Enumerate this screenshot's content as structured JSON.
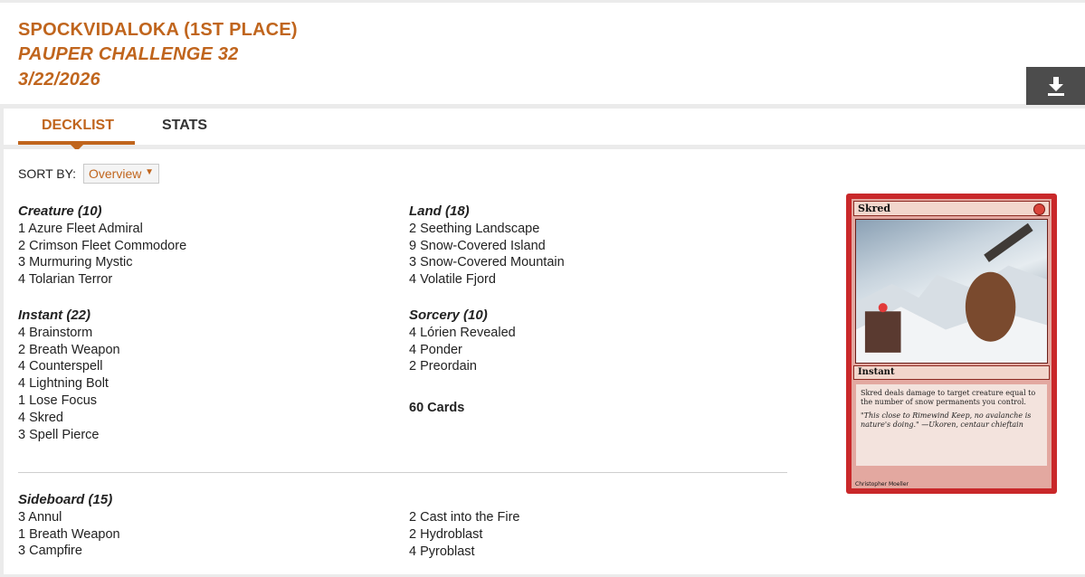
{
  "header": {
    "player": "SPOCKVIDALOKA (1ST PLACE)",
    "event": "PAUPER CHALLENGE 32",
    "date": "3/22/2026",
    "download_icon": "download-icon"
  },
  "tabs": [
    {
      "label": "DECKLIST",
      "active": true
    },
    {
      "label": "STATS",
      "active": false
    }
  ],
  "sort": {
    "label": "SORT BY:",
    "selected": "Overview"
  },
  "deck": {
    "creature": {
      "title": "Creature (10)",
      "cards": [
        "1 Azure Fleet Admiral",
        "2 Crimson Fleet Commodore",
        "3 Murmuring Mystic",
        "4 Tolarian Terror"
      ]
    },
    "instant": {
      "title": "Instant (22)",
      "cards": [
        "4 Brainstorm",
        "2 Breath Weapon",
        "4 Counterspell",
        "4 Lightning Bolt",
        "1 Lose Focus",
        "4 Skred",
        "3 Spell Pierce"
      ]
    },
    "land": {
      "title": "Land (18)",
      "cards": [
        "2 Seething Landscape",
        "9 Snow-Covered Island",
        "3 Snow-Covered Mountain",
        "4 Volatile Fjord"
      ]
    },
    "sorcery": {
      "title": "Sorcery (10)",
      "cards": [
        "4 Lórien Revealed",
        "4 Ponder",
        "2 Preordain"
      ]
    },
    "total": "60 Cards",
    "sideboard": {
      "title": "Sideboard (15)",
      "left": [
        "3 Annul",
        "1 Breath Weapon",
        "3 Campfire"
      ],
      "right": [
        "2 Cast into the Fire",
        "2 Hydroblast",
        "4 Pyroblast"
      ]
    }
  },
  "card_preview": {
    "name": "Skred",
    "type": "Instant",
    "rules": "Skred deals damage to target creature equal to the number of snow permanents you control.",
    "flavor": "\"This close to Rimewind Keep, no avalanche is nature's doing.\" —Ukoren, centaur chieftain",
    "artist": "Christopher Moeller",
    "colors": {
      "frame": "#c9282a",
      "accent": "#c0651d"
    }
  }
}
